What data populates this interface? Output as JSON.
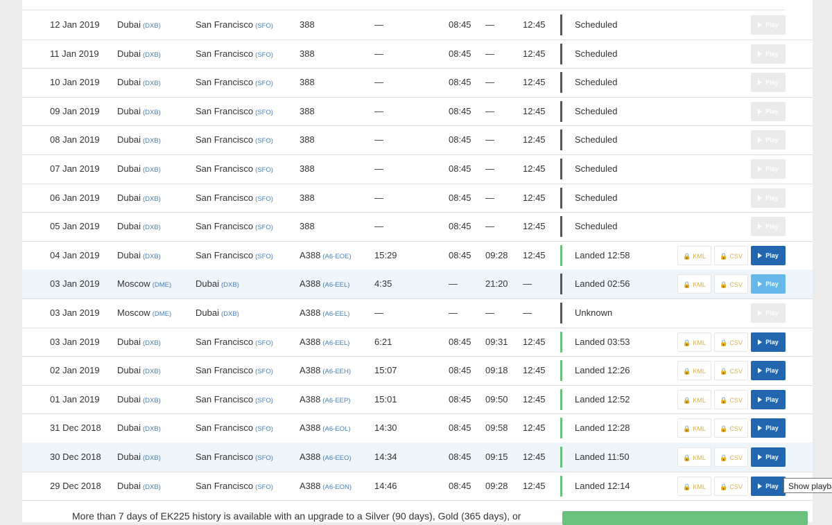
{
  "flights": [
    {
      "date": "12 Jan 2019",
      "from": "Dubai",
      "from_code": "(DXB)",
      "to": "San Francisco",
      "to_code": "(SFO)",
      "aircraft": "388",
      "reg": "",
      "duration": "—",
      "std": "08:45",
      "atd": "—",
      "sta": "12:45",
      "status": "Scheduled",
      "state": "scheduled",
      "highlight": false,
      "kml": "",
      "csv": "",
      "play": "Play",
      "play_style": "disabled"
    },
    {
      "date": "11 Jan 2019",
      "from": "Dubai",
      "from_code": "(DXB)",
      "to": "San Francisco",
      "to_code": "(SFO)",
      "aircraft": "388",
      "reg": "",
      "duration": "—",
      "std": "08:45",
      "atd": "—",
      "sta": "12:45",
      "status": "Scheduled",
      "state": "scheduled",
      "highlight": false,
      "kml": "",
      "csv": "",
      "play": "Play",
      "play_style": "disabled"
    },
    {
      "date": "10 Jan 2019",
      "from": "Dubai",
      "from_code": "(DXB)",
      "to": "San Francisco",
      "to_code": "(SFO)",
      "aircraft": "388",
      "reg": "",
      "duration": "—",
      "std": "08:45",
      "atd": "—",
      "sta": "12:45",
      "status": "Scheduled",
      "state": "scheduled",
      "highlight": false,
      "kml": "",
      "csv": "",
      "play": "Play",
      "play_style": "disabled"
    },
    {
      "date": "09 Jan 2019",
      "from": "Dubai",
      "from_code": "(DXB)",
      "to": "San Francisco",
      "to_code": "(SFO)",
      "aircraft": "388",
      "reg": "",
      "duration": "—",
      "std": "08:45",
      "atd": "—",
      "sta": "12:45",
      "status": "Scheduled",
      "state": "scheduled",
      "highlight": false,
      "kml": "",
      "csv": "",
      "play": "Play",
      "play_style": "disabled"
    },
    {
      "date": "08 Jan 2019",
      "from": "Dubai",
      "from_code": "(DXB)",
      "to": "San Francisco",
      "to_code": "(SFO)",
      "aircraft": "388",
      "reg": "",
      "duration": "—",
      "std": "08:45",
      "atd": "—",
      "sta": "12:45",
      "status": "Scheduled",
      "state": "scheduled",
      "highlight": false,
      "kml": "",
      "csv": "",
      "play": "Play",
      "play_style": "disabled"
    },
    {
      "date": "07 Jan 2019",
      "from": "Dubai",
      "from_code": "(DXB)",
      "to": "San Francisco",
      "to_code": "(SFO)",
      "aircraft": "388",
      "reg": "",
      "duration": "—",
      "std": "08:45",
      "atd": "—",
      "sta": "12:45",
      "status": "Scheduled",
      "state": "scheduled",
      "highlight": false,
      "kml": "",
      "csv": "",
      "play": "Play",
      "play_style": "disabled"
    },
    {
      "date": "06 Jan 2019",
      "from": "Dubai",
      "from_code": "(DXB)",
      "to": "San Francisco",
      "to_code": "(SFO)",
      "aircraft": "388",
      "reg": "",
      "duration": "—",
      "std": "08:45",
      "atd": "—",
      "sta": "12:45",
      "status": "Scheduled",
      "state": "scheduled",
      "highlight": false,
      "kml": "",
      "csv": "",
      "play": "Play",
      "play_style": "disabled"
    },
    {
      "date": "05 Jan 2019",
      "from": "Dubai",
      "from_code": "(DXB)",
      "to": "San Francisco",
      "to_code": "(SFO)",
      "aircraft": "388",
      "reg": "",
      "duration": "—",
      "std": "08:45",
      "atd": "—",
      "sta": "12:45",
      "status": "Scheduled",
      "state": "scheduled",
      "highlight": false,
      "kml": "",
      "csv": "",
      "play": "Play",
      "play_style": "disabled"
    },
    {
      "date": "04 Jan 2019",
      "from": "Dubai",
      "from_code": "(DXB)",
      "to": "San Francisco",
      "to_code": "(SFO)",
      "aircraft": "A388",
      "reg": "(A6-EOE)",
      "duration": "15:29",
      "std": "08:45",
      "atd": "09:28",
      "sta": "12:45",
      "status": "Landed 12:58",
      "state": "landed",
      "highlight": false,
      "kml": "KML",
      "csv": "CSV",
      "play": "Play",
      "play_style": "active"
    },
    {
      "date": "03 Jan 2019",
      "from": "Moscow",
      "from_code": "(DME)",
      "to": "Dubai",
      "to_code": "(DXB)",
      "aircraft": "A388",
      "reg": "(A6-EEL)",
      "duration": "4:35",
      "std": "—",
      "atd": "21:20",
      "sta": "—",
      "status": "Landed 02:56",
      "state": "other",
      "highlight": true,
      "kml": "KML",
      "csv": "CSV",
      "play": "Play",
      "play_style": "light"
    },
    {
      "date": "03 Jan 2019",
      "from": "Moscow",
      "from_code": "(DME)",
      "to": "Dubai",
      "to_code": "(DXB)",
      "aircraft": "A388",
      "reg": "(A6-EEL)",
      "duration": "—",
      "std": "—",
      "atd": "—",
      "sta": "—",
      "status": "Unknown",
      "state": "other",
      "highlight": false,
      "kml": "",
      "csv": "",
      "play": "Play",
      "play_style": "disabled"
    },
    {
      "date": "03 Jan 2019",
      "from": "Dubai",
      "from_code": "(DXB)",
      "to": "San Francisco",
      "to_code": "(SFO)",
      "aircraft": "A388",
      "reg": "(A6-EEL)",
      "duration": "6:21",
      "std": "08:45",
      "atd": "09:31",
      "sta": "12:45",
      "status": "Landed 03:53",
      "state": "landed",
      "highlight": false,
      "kml": "KML",
      "csv": "CSV",
      "play": "Play",
      "play_style": "active"
    },
    {
      "date": "02 Jan 2019",
      "from": "Dubai",
      "from_code": "(DXB)",
      "to": "San Francisco",
      "to_code": "(SFO)",
      "aircraft": "A388",
      "reg": "(A6-EEH)",
      "duration": "15:07",
      "std": "08:45",
      "atd": "09:18",
      "sta": "12:45",
      "status": "Landed 12:26",
      "state": "landed",
      "highlight": false,
      "kml": "KML",
      "csv": "CSV",
      "play": "Play",
      "play_style": "active"
    },
    {
      "date": "01 Jan 2019",
      "from": "Dubai",
      "from_code": "(DXB)",
      "to": "San Francisco",
      "to_code": "(SFO)",
      "aircraft": "A388",
      "reg": "(A6-EEP)",
      "duration": "15:01",
      "std": "08:45",
      "atd": "09:50",
      "sta": "12:45",
      "status": "Landed 12:52",
      "state": "landed",
      "highlight": false,
      "kml": "KML",
      "csv": "CSV",
      "play": "Play",
      "play_style": "active"
    },
    {
      "date": "31 Dec 2018",
      "from": "Dubai",
      "from_code": "(DXB)",
      "to": "San Francisco",
      "to_code": "(SFO)",
      "aircraft": "A388",
      "reg": "(A6-EOL)",
      "duration": "14:30",
      "std": "08:45",
      "atd": "09:58",
      "sta": "12:45",
      "status": "Landed 12:28",
      "state": "landed",
      "highlight": false,
      "kml": "KML",
      "csv": "CSV",
      "play": "Play",
      "play_style": "active"
    },
    {
      "date": "30 Dec 2018",
      "from": "Dubai",
      "from_code": "(DXB)",
      "to": "San Francisco",
      "to_code": "(SFO)",
      "aircraft": "A388",
      "reg": "(A6-EEO)",
      "duration": "14:34",
      "std": "08:45",
      "atd": "09:15",
      "sta": "12:45",
      "status": "Landed 11:50",
      "state": "landed",
      "highlight": true,
      "kml": "KML",
      "csv": "CSV",
      "play": "Play",
      "play_style": "active"
    },
    {
      "date": "29 Dec 2018",
      "from": "Dubai",
      "from_code": "(DXB)",
      "to": "San Francisco",
      "to_code": "(SFO)",
      "aircraft": "A388",
      "reg": "(A6-EON)",
      "duration": "14:46",
      "std": "08:45",
      "atd": "09:28",
      "sta": "12:45",
      "status": "Landed 12:14",
      "state": "landed",
      "highlight": false,
      "kml": "KML",
      "csv": "CSV",
      "play": "Play",
      "play_style": "active"
    }
  ],
  "tooltip": "Show playback",
  "footer": {
    "history_text": "More than 7 days of EK225 history is available with an upgrade to a Silver (90 days), Gold (365 days), or"
  },
  "icons": {
    "lock": "lock-icon",
    "play": "play-icon"
  },
  "colors": {
    "landed_bar": "#6cc07e",
    "other_bar": "#555555",
    "play_active": "#2166ae",
    "play_light": "#66b8ea",
    "play_disabled": "#ebebeb",
    "airport_code": "#4a7fb5",
    "lock": "#d4b250",
    "row_highlight": "#eef5fb"
  }
}
